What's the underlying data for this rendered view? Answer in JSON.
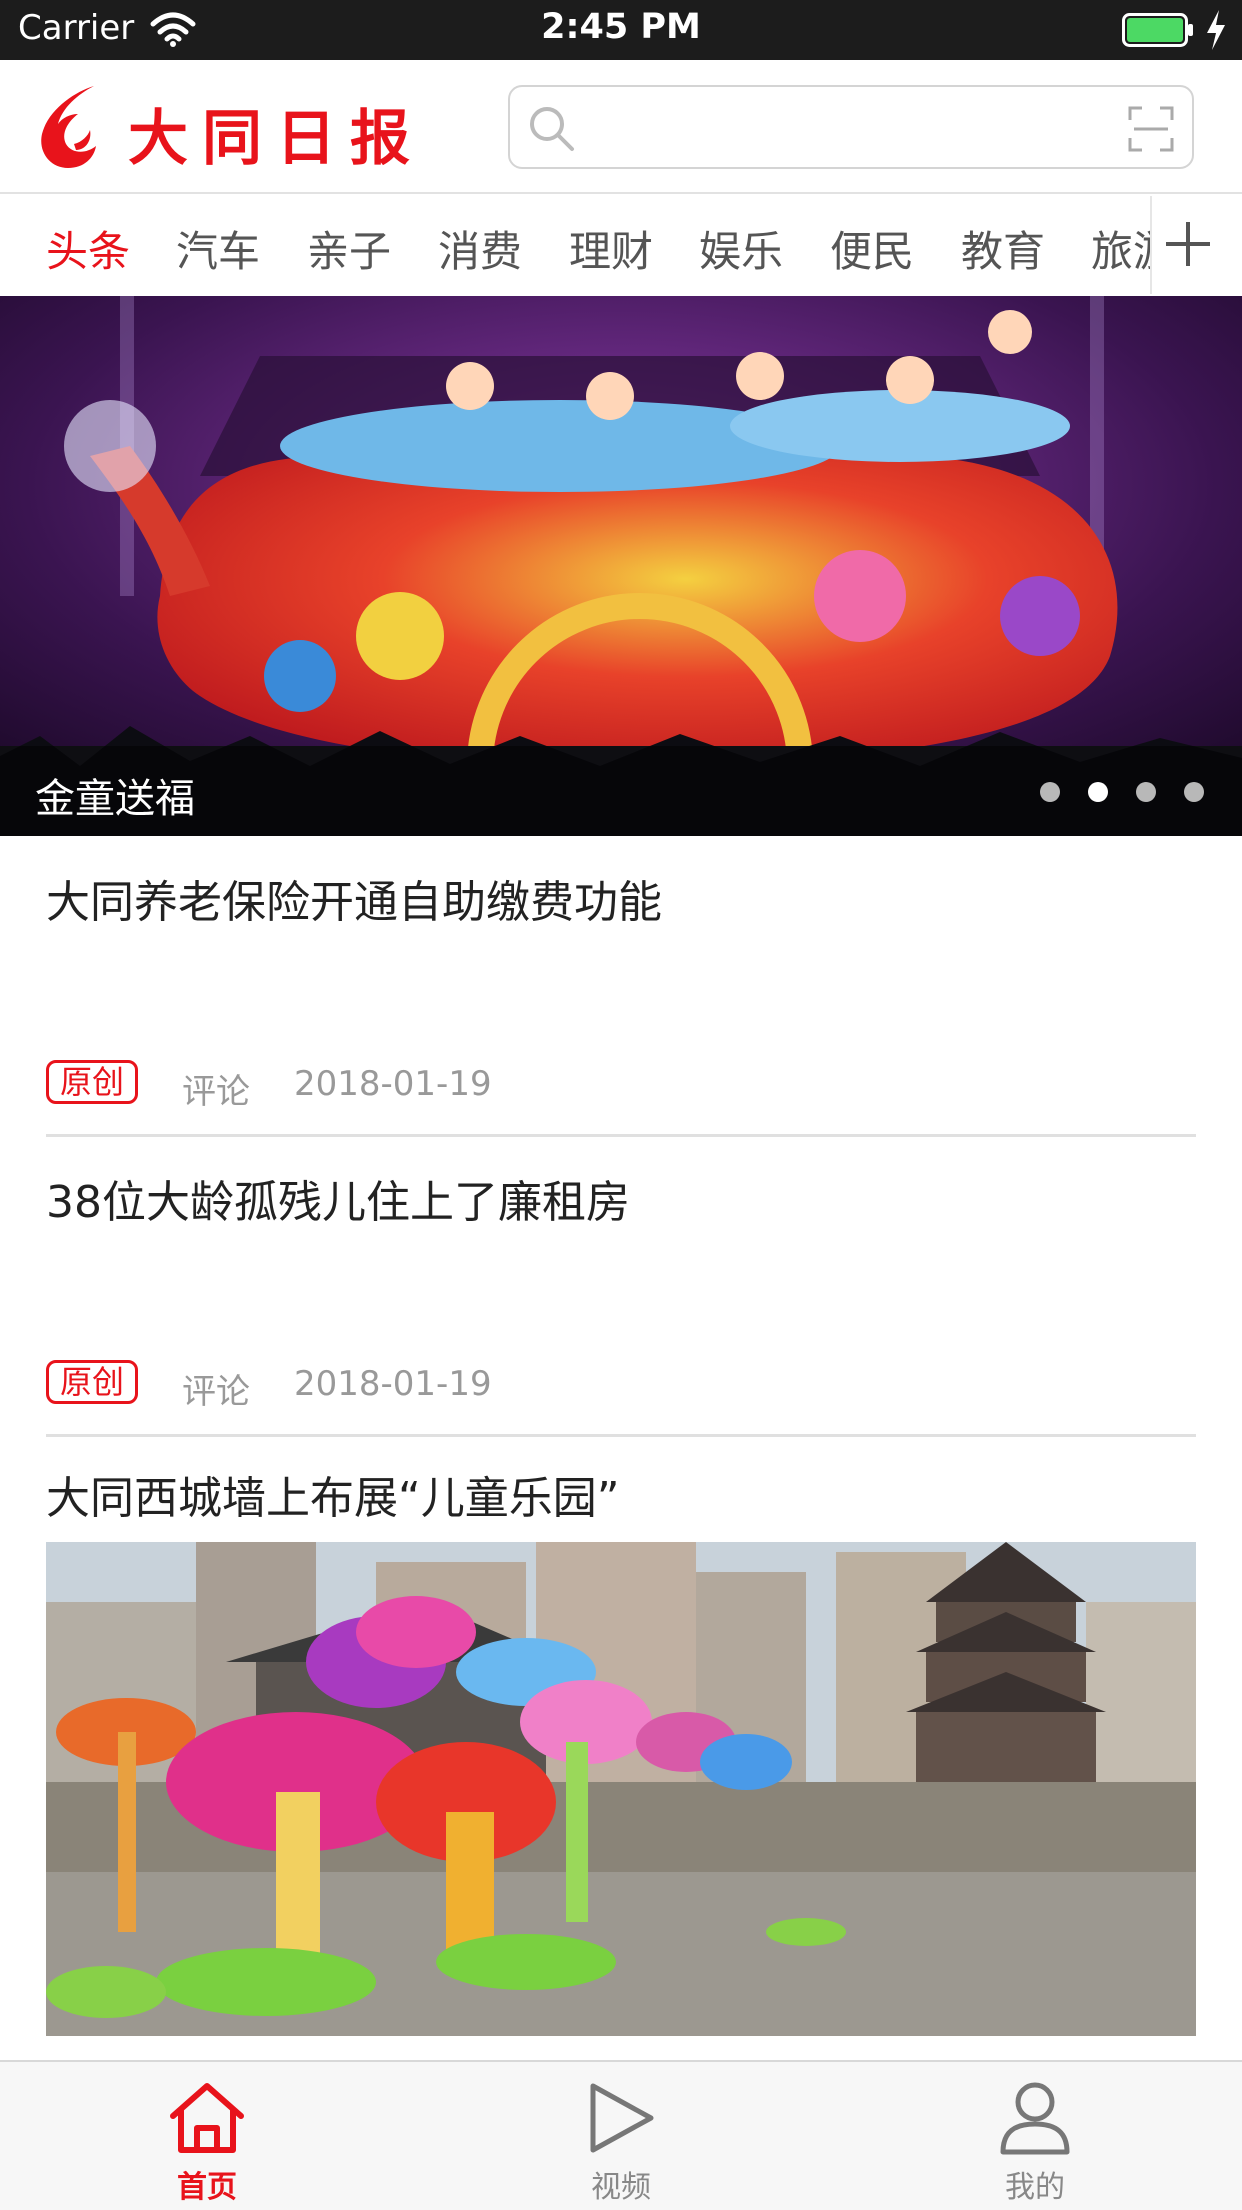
{
  "status_bar": {
    "carrier": "Carrier",
    "time": "2:45 PM",
    "battery_icon": "battery-full-icon"
  },
  "header": {
    "app_title": "大同日报",
    "logo_icon": "flame-logo-icon",
    "search": {
      "placeholder": "",
      "icon": "search-icon",
      "scan_icon": "scan-icon"
    }
  },
  "tabs": [
    {
      "label": "头条",
      "active": true
    },
    {
      "label": "汽车"
    },
    {
      "label": "亲子"
    },
    {
      "label": "消费"
    },
    {
      "label": "理财"
    },
    {
      "label": "娱乐"
    },
    {
      "label": "便民"
    },
    {
      "label": "教育"
    },
    {
      "label": "旅游"
    }
  ],
  "add_tab_icon": "plus-icon",
  "carousel": {
    "caption": "金童送福",
    "dot_count": 4,
    "active_dot": 2
  },
  "news": [
    {
      "title": "大同养老保险开通自助缴费功能",
      "tag": "原创",
      "comment": "评论",
      "date": "2018-01-19"
    },
    {
      "title": "38位大龄孤残儿住上了廉租房",
      "tag": "原创",
      "comment": "评论",
      "date": "2018-01-19"
    },
    {
      "title": "大同西城墙上布展“儿童乐园”"
    }
  ],
  "bottom_nav": [
    {
      "label": "首页",
      "icon": "home-icon",
      "active": true
    },
    {
      "label": "视频",
      "icon": "play-icon"
    },
    {
      "label": "我的",
      "icon": "user-icon"
    }
  ],
  "colors": {
    "accent": "#e8131b",
    "status_bar": "#1c1c1c",
    "battery": "#4cd964"
  }
}
